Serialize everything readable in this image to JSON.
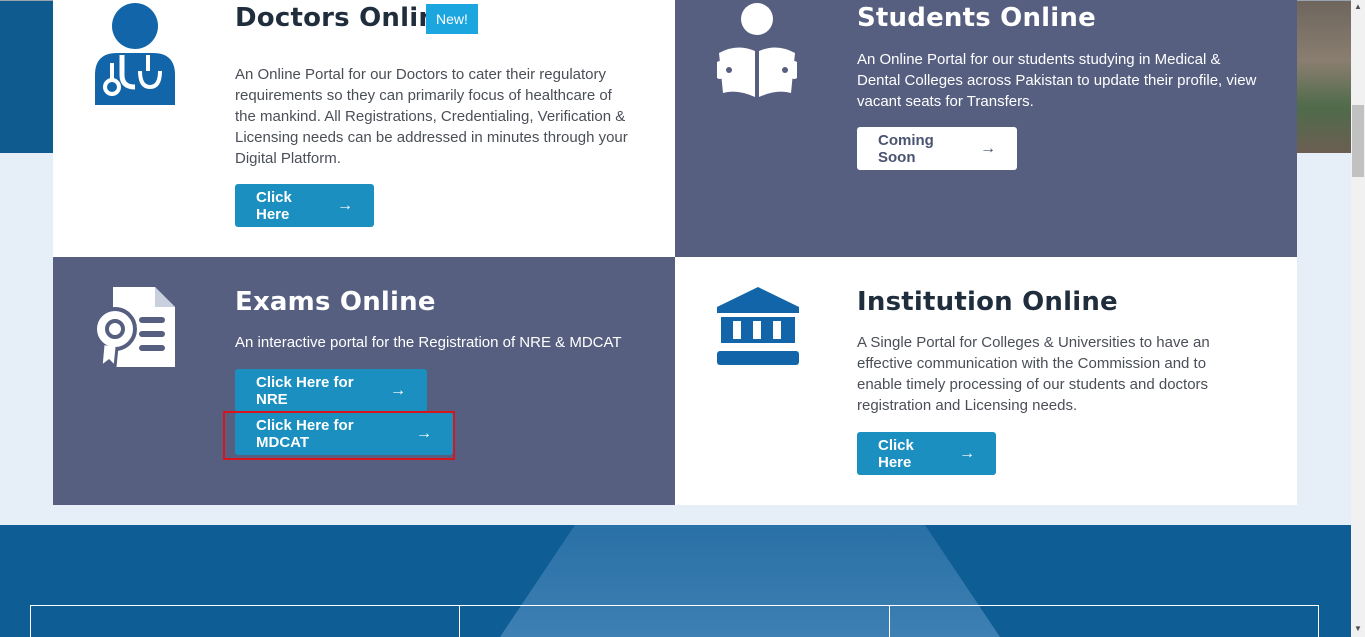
{
  "cards": {
    "doctors": {
      "title": "Doctors Online",
      "badge": "New!",
      "description": "An Online Portal for our Doctors to cater their regulatory requirements so they can primarily focus of healthcare of the mankind. All Registrations, Credentialing, Verification & Licensing needs can be addressed in minutes through your Digital Platform.",
      "button": "Click Here",
      "icon": "doctor-icon"
    },
    "students": {
      "title": "Students Online",
      "description": "An Online Portal for our students studying in Medical & Dental Colleges across Pakistan to update their profile, view vacant seats for Transfers.",
      "button": "Coming Soon",
      "icon": "student-reading-icon"
    },
    "exams": {
      "title": "Exams Online",
      "description": "An interactive portal for the Registration of NRE & MDCAT",
      "button_nre": "Click Here for NRE",
      "button_mdcat": "Click Here for MDCAT",
      "icon": "certificate-document-icon"
    },
    "institution": {
      "title": "Institution Online",
      "description": "A Single Portal for Colleges & Universities to have an effective communication with the Commission and to enable timely processing of our students and doctors registration and Licensing needs.",
      "button": "Click Here",
      "icon": "institution-building-icon"
    }
  },
  "colors": {
    "primary_button": "#1a8fc0",
    "dark_card": "#565f80",
    "footer": "#0e5d95",
    "highlight": "#d8141c",
    "icon_blue": "#1165a8"
  },
  "icons": {
    "arrow": "→",
    "scroll_up": "▲",
    "scroll_down": "▼"
  }
}
